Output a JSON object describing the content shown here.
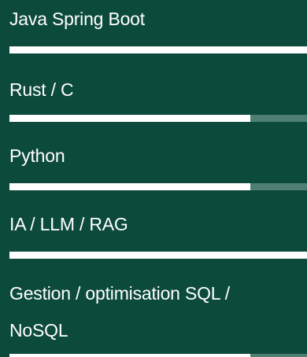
{
  "skills": [
    {
      "label": "Java Spring Boot",
      "level_percent": 100
    },
    {
      "label": "Rust / C",
      "level_percent": 81
    },
    {
      "label": "Python",
      "level_percent": 81
    },
    {
      "label": "IA / LLM / RAG",
      "level_percent": 100
    },
    {
      "label": "Gestion / optimisation SQL / NoSQL",
      "level_percent": 81
    }
  ],
  "colors": {
    "background": "#0c4a3c",
    "bar_fill": "#ffffff",
    "bar_track": "#4f7f73",
    "text": "#ffffff"
  }
}
